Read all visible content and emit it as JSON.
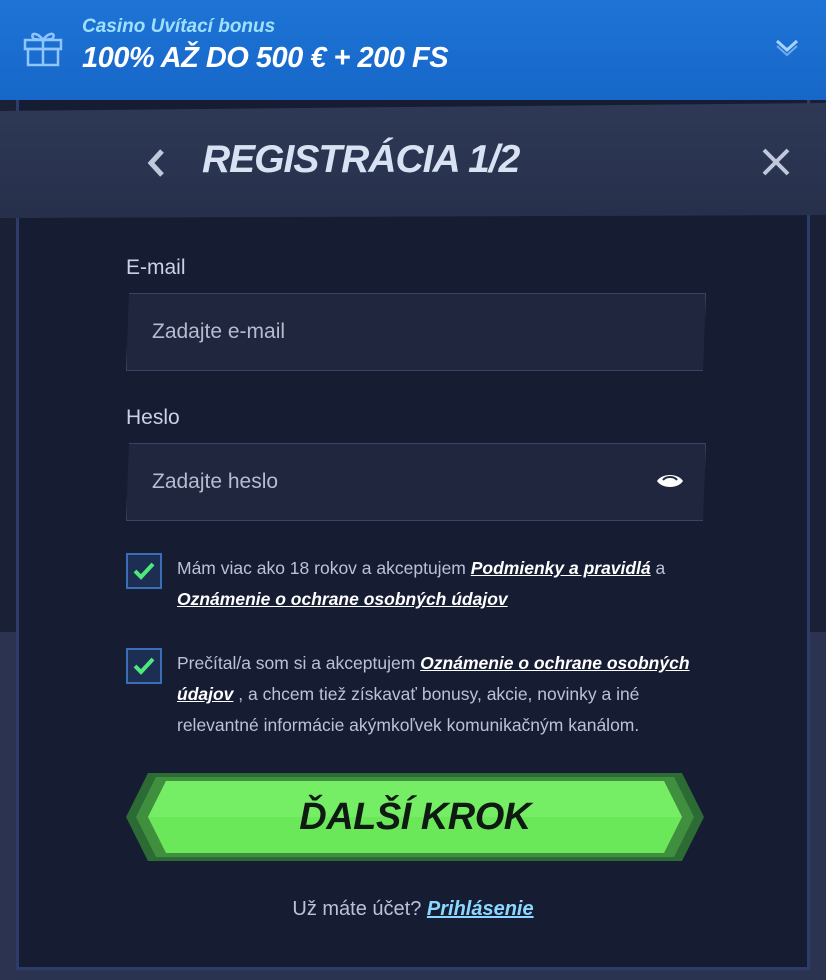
{
  "promo": {
    "subtitle": "Casino Uvítací bonus",
    "title": "100% AŽ DO 500 € + 200 FS",
    "icon": "gift-icon",
    "toggle_icon": "chevron-down-icon"
  },
  "modal": {
    "title": "REGISTRÁCIA 1/2",
    "back_icon": "chevron-left-icon",
    "close_icon": "close-icon"
  },
  "form": {
    "email": {
      "label": "E-mail",
      "placeholder": "Zadajte e-mail",
      "value": ""
    },
    "password": {
      "label": "Heslo",
      "placeholder": "Zadajte heslo",
      "value": "",
      "toggle_icon": "eye-icon"
    },
    "consents": [
      {
        "checked": true,
        "text_before": "Mám viac ako 18 rokov a akceptujem ",
        "link1": "Podmienky a pravidlá",
        "text_middle": " a ",
        "link2": "Oznámenie o ochrane osobných údajov",
        "text_after": ""
      },
      {
        "checked": true,
        "text_before": "Prečítal/a som si a akceptujem ",
        "link1": "Oznámenie o ochrane osobných údajov",
        "text_after": " , a chcem tiež získavať bonusy, akcie, novinky a iné relevantné informácie akýmkoľvek komunikačným kanálom."
      }
    ],
    "submit_label": "ĎALŠÍ KROK"
  },
  "footer": {
    "question": "Už máte účet?",
    "login_link": "Prihlásenie"
  },
  "colors": {
    "promo_bg": "#1667c8",
    "modal_bg": "#161d33",
    "cta_green": "#6be85a",
    "check_green": "#4ee87a",
    "link_blue": "#8ad8ff"
  }
}
